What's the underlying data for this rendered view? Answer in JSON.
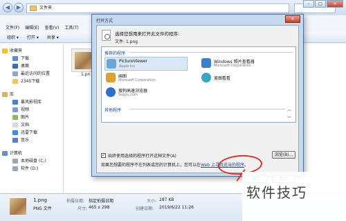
{
  "explorer": {
    "path": "文件夹",
    "menu": [
      "文件(F)",
      "编辑(E)",
      "查看(V)",
      "工具(T)"
    ],
    "toolbar": [
      "组织 ▾",
      "打开 ▾",
      "共享 ▾"
    ],
    "sidebar": {
      "favorites": "收藏夹",
      "fav_items": [
        "下载",
        "桌面",
        "最近访问的位置",
        "2345下载"
      ],
      "library": "库",
      "lib_items": [
        "暴风影视库",
        "视频",
        "图片",
        "文档",
        "迅雷下载",
        "音乐"
      ],
      "computer": "计算机",
      "comp_items": [
        "本地磁盘 (C:)",
        "软件 (D:)"
      ]
    },
    "file_label": "1.pn",
    "details": {
      "name": "1.png",
      "type": "PNG 文件",
      "shot_date_label": "拍摄日期:",
      "shot_date_value": "指定拍摄日期",
      "dimensions_label": "尺寸:",
      "dimensions_value": "465 x 298",
      "size_label": "大小:",
      "size_value": "287 KB",
      "created_label": "创建日期:",
      "created_value": "2019/6/22 11:26"
    }
  },
  "dialog": {
    "title": "打开方式",
    "prompt": "选择您想用来打开此文件的程序:",
    "file_line": "文件:  1.png",
    "recommended_header": "推荐的程序",
    "apps": [
      {
        "name": "PictureViewer",
        "vendor": "Apple Inc",
        "color": "#6aa7d8"
      },
      {
        "name": "Windows 照片查看器",
        "vendor": "Microsoft Corporation",
        "color": "#3b7fc9"
      },
      {
        "name": "画图",
        "vendor": "Microsoft Corporation",
        "color": "#e0a030"
      },
      {
        "name": "美图看看",
        "vendor": "",
        "color": "#35a6c8"
      },
      {
        "name": "搜狗高速浏览器",
        "vendor": "Sogou.com",
        "color": "#2d6fd0"
      }
    ],
    "other_header": "其他程序",
    "always_use": "始终使用选择的程序打开这种文件(A)",
    "browse": "浏览(B)...",
    "hint_prefix": "如果您想要的程序不在列表或您的计算机上，您可以在",
    "hint_link": "Web 上寻找适当的程序",
    "hint_suffix": "。",
    "ok": "确定",
    "cancel": "取消"
  },
  "watermark": "软件技巧",
  "colors": {
    "annotation": "#e0301e",
    "accent": "#1a4aa0"
  }
}
